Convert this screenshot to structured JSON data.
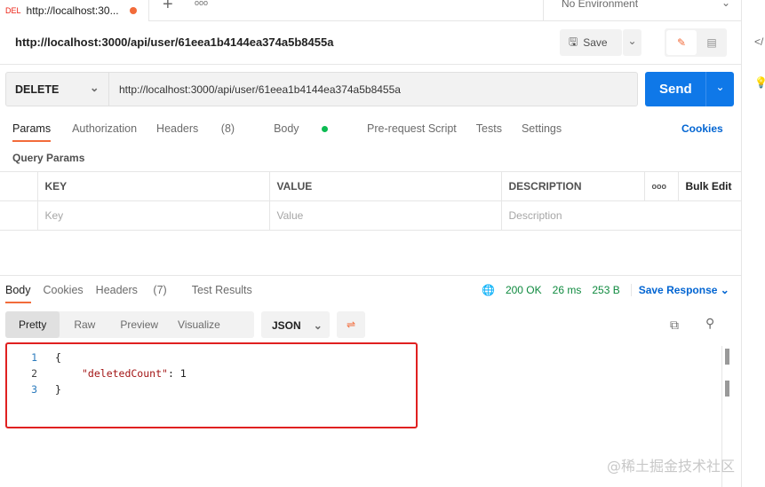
{
  "tab": {
    "method": "DEL",
    "title": "http://localhost:30...",
    "new": "+",
    "more": "ooo"
  },
  "environment": "No Environment",
  "request": {
    "title": "http://localhost:3000/api/user/61eea1b4144ea374a5b8455a",
    "save": "Save",
    "method": "DELETE",
    "url": "http://localhost:3000/api/user/61eea1b4144ea374a5b8455a",
    "send": "Send"
  },
  "req_tabs": [
    {
      "label": "Params"
    },
    {
      "label": "Authorization"
    },
    {
      "label": "Headers",
      "count": "(8)"
    },
    {
      "label": "Body"
    },
    {
      "label": "Pre-request Script"
    },
    {
      "label": "Tests"
    },
    {
      "label": "Settings"
    }
  ],
  "cookies": "Cookies",
  "query_params": "Query Params",
  "table": {
    "headers": [
      "KEY",
      "VALUE",
      "DESCRIPTION"
    ],
    "bulk_edit": "Bulk Edit",
    "placeholders": [
      "Key",
      "Value",
      "Description"
    ],
    "more": "ooo"
  },
  "resp_tabs": [
    {
      "label": "Body"
    },
    {
      "label": "Cookies"
    },
    {
      "label": "Headers",
      "count": "(7)"
    },
    {
      "label": "Test Results"
    }
  ],
  "status": {
    "code": "200 OK",
    "time": "26 ms",
    "size": "253 B",
    "save_response": "Save Response"
  },
  "view_modes": [
    "Pretty",
    "Raw",
    "Preview",
    "Visualize"
  ],
  "format": "JSON",
  "code_lines": [
    {
      "n": "1",
      "text": "{"
    },
    {
      "n": "2",
      "key": "\"deletedCount\"",
      "value": ": 1"
    },
    {
      "n": "3",
      "text": "}"
    }
  ],
  "watermark": "@稀土掘金技术社区",
  "colors": {
    "accent": "#0265d2",
    "highlight": "#e02020",
    "status": "#0f8a3f"
  }
}
